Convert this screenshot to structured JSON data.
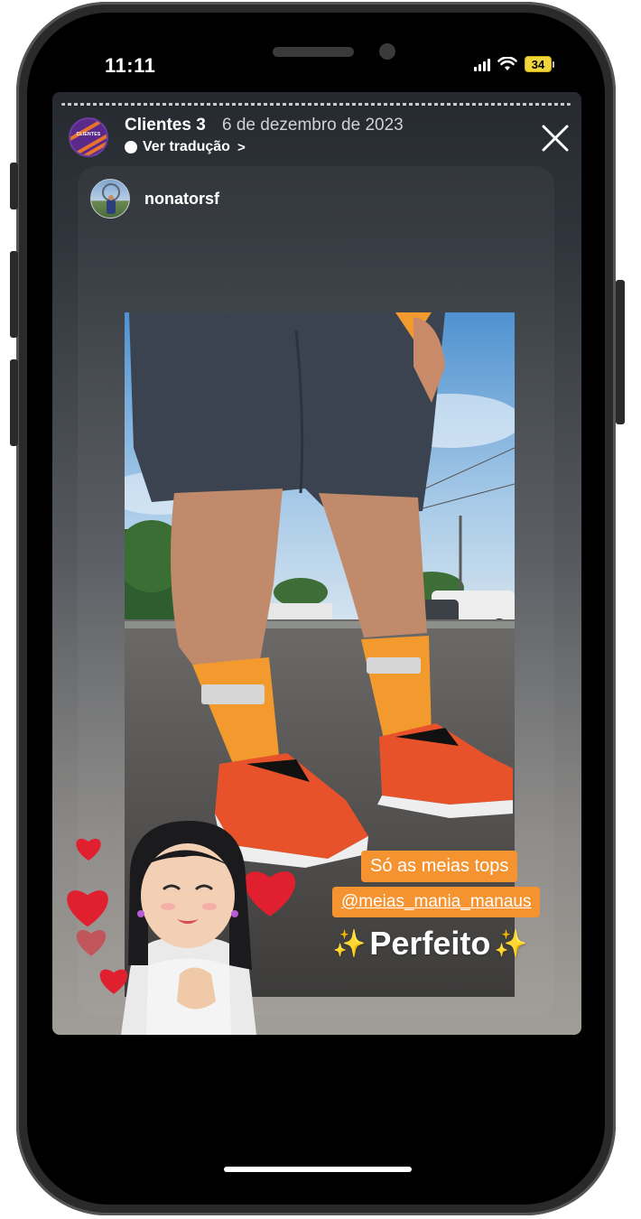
{
  "status_bar": {
    "time": "11:11",
    "battery": "34"
  },
  "story_header": {
    "avatar_label": "CLIENTES",
    "title": "Clientes 3",
    "date": "6 de dezembro de 2023",
    "translate_label": "Ver tradução"
  },
  "shared_post": {
    "username": "nonatorsf"
  },
  "overlay": {
    "caption_line1": "Só as meias tops",
    "caption_line2": "@meias_mania_manaus",
    "highlight": "Perfeito"
  },
  "colors": {
    "caption_bg": "#f4932f",
    "sock_orange": "#f29a2e",
    "shoe_orange": "#e8522a",
    "heart_red": "#e0202f"
  }
}
